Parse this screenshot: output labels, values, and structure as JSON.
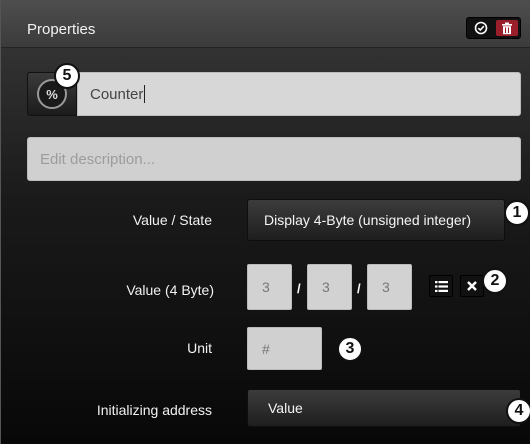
{
  "header": {
    "title": "Properties"
  },
  "name_field": {
    "icon_label": "%",
    "value": "Counter"
  },
  "description_field": {
    "placeholder": "Edit description..."
  },
  "rows": {
    "value_state": {
      "label": "Value / State",
      "selected": "Display 4-Byte (unsigned integer)"
    },
    "value_4byte": {
      "label": "Value (4 Byte)",
      "parts": [
        "3",
        "3",
        "3"
      ],
      "separator": "/"
    },
    "unit": {
      "label": "Unit",
      "value": "#"
    },
    "init_address": {
      "label": "Initializing address",
      "selected": "Value"
    }
  },
  "callouts": [
    "1",
    "2",
    "3",
    "4",
    "5"
  ],
  "colors": {
    "delete": "#9a1f2a",
    "field_bg": "#d2d2d2",
    "header_bg": "#444444"
  }
}
